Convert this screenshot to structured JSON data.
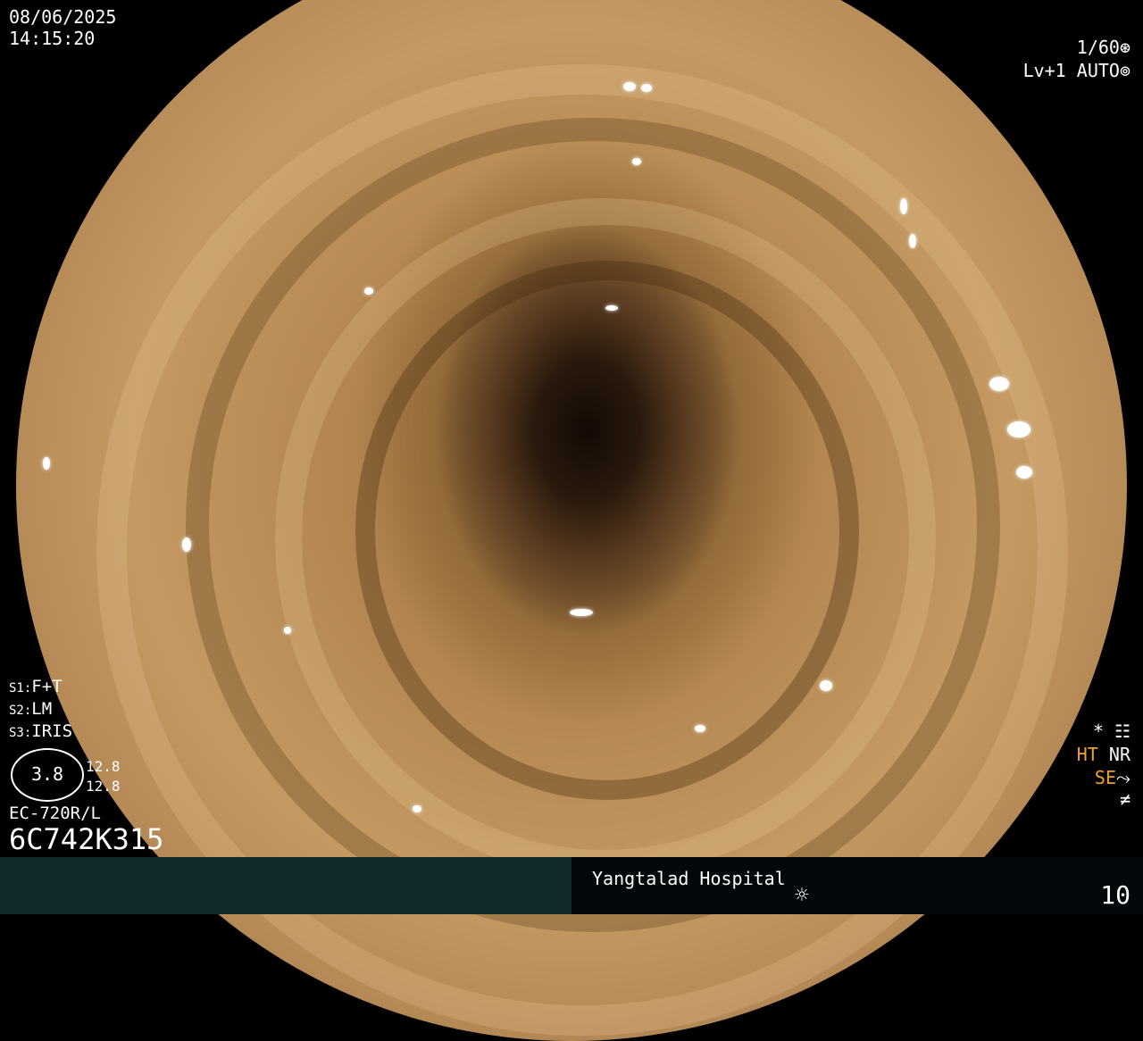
{
  "header": {
    "date": "08/06/2025",
    "time": "14:15:20",
    "shutter": "1/60",
    "shutter_icon": "shutter-icon",
    "level": "Lv+1",
    "mode": "AUTO",
    "mode_icon": "iris-icon"
  },
  "settings": {
    "s1": {
      "prefix": "S1:",
      "value": "F+T"
    },
    "s2": {
      "prefix": "S2:",
      "value": "LM"
    },
    "s3": {
      "prefix": "S3:",
      "value": "IRIS"
    },
    "zoom": "3.8",
    "zoom_a": "12.8",
    "zoom_b": "12.8"
  },
  "scope": {
    "model": "EC-720R/L",
    "serial": "6C742K315"
  },
  "indicators": {
    "star": "*",
    "star_icon": "settings-sliders-icon",
    "ht": "HT",
    "nr": "NR",
    "se": "SE",
    "se_icon": "curve-icon",
    "flicker": "≠"
  },
  "footer": {
    "hospital": "Yangtalad Hospital",
    "sun_icon": "brightness-icon",
    "count": "10"
  },
  "colors": {
    "amber": "#f0a028",
    "footer_left": "#0f2a28",
    "footer_right": "#02080a"
  }
}
